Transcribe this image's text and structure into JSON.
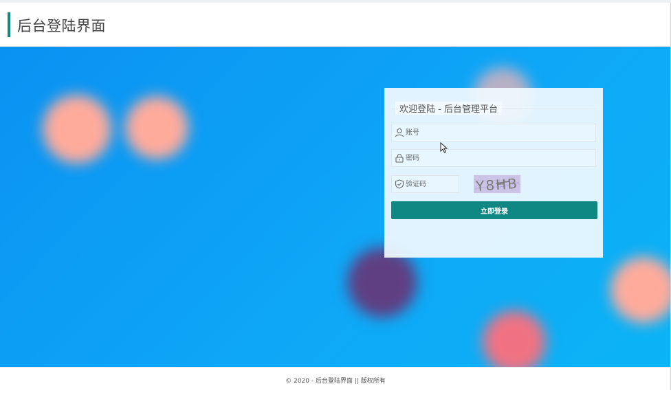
{
  "header": {
    "title": "后台登陆界面"
  },
  "login": {
    "legend": "欢迎登陆 - 后台管理平台",
    "username_placeholder": "账号",
    "password_placeholder": "密码",
    "captcha_placeholder": "验证码",
    "captcha_text": "Y8HB",
    "submit_label": "立即登录"
  },
  "footer": {
    "text": "© 2020 - 后台登陆界面 || 版权所有"
  },
  "colors": {
    "accent": "#0f8a80",
    "button": "#0f8883",
    "background_start": "#0a92f2",
    "background_end": "#0bb4f6"
  }
}
